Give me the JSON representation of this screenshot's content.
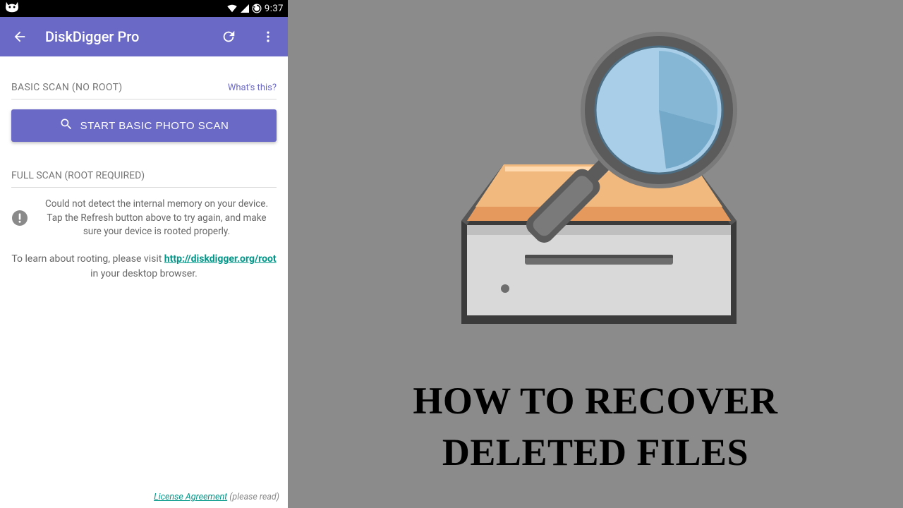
{
  "status": {
    "time": "9:37"
  },
  "appbar": {
    "title": "DiskDigger Pro"
  },
  "basic": {
    "title": "BASIC SCAN (NO ROOT)",
    "whats_this": "What's this?",
    "button": "START BASIC PHOTO SCAN"
  },
  "full": {
    "title": "FULL SCAN (ROOT REQUIRED)",
    "warn": "Could not detect the internal memory on your device. Tap the Refresh button above to try again, and make sure your device is rooted properly.",
    "root_info_pre": "To learn about rooting, please visit ",
    "root_link": "http://diskdigger.org/root",
    "root_info_post": " in your desktop browser."
  },
  "footer": {
    "license_link": "License Agreement",
    "please_read": " (please read)"
  },
  "right": {
    "headline_line1": "HOW TO RECOVER",
    "headline_line2": "DELETED FILES"
  },
  "colors": {
    "accent": "#6b69c6",
    "teal": "#009688",
    "gray_bg": "#8b8b8b"
  }
}
